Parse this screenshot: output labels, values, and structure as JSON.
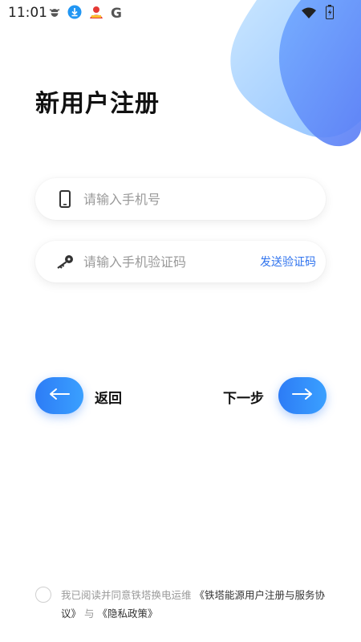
{
  "status_bar": {
    "time": "11:01",
    "left_icons": [
      "bug-icon",
      "download-icon",
      "avatar-icon",
      "google-icon"
    ],
    "right_icons": [
      "wifi-icon",
      "battery-icon"
    ]
  },
  "page": {
    "title": "新用户注册"
  },
  "form": {
    "phone_placeholder": "请输入手机号",
    "code_placeholder": "请输入手机验证码",
    "send_code_label": "发送验证码"
  },
  "nav": {
    "back_label": "返回",
    "next_label": "下一步"
  },
  "agreement": {
    "checked": false,
    "prefix": "我已阅读并同意铁塔换电运维",
    "link1": "《铁塔能源用户注册与服务协议》",
    "joiner": "与",
    "link2": "《隐私政策》"
  },
  "colors": {
    "accent": "#2f73ee",
    "button_gradient_start": "#2d7cf6",
    "button_gradient_end": "#3aa0ff"
  }
}
